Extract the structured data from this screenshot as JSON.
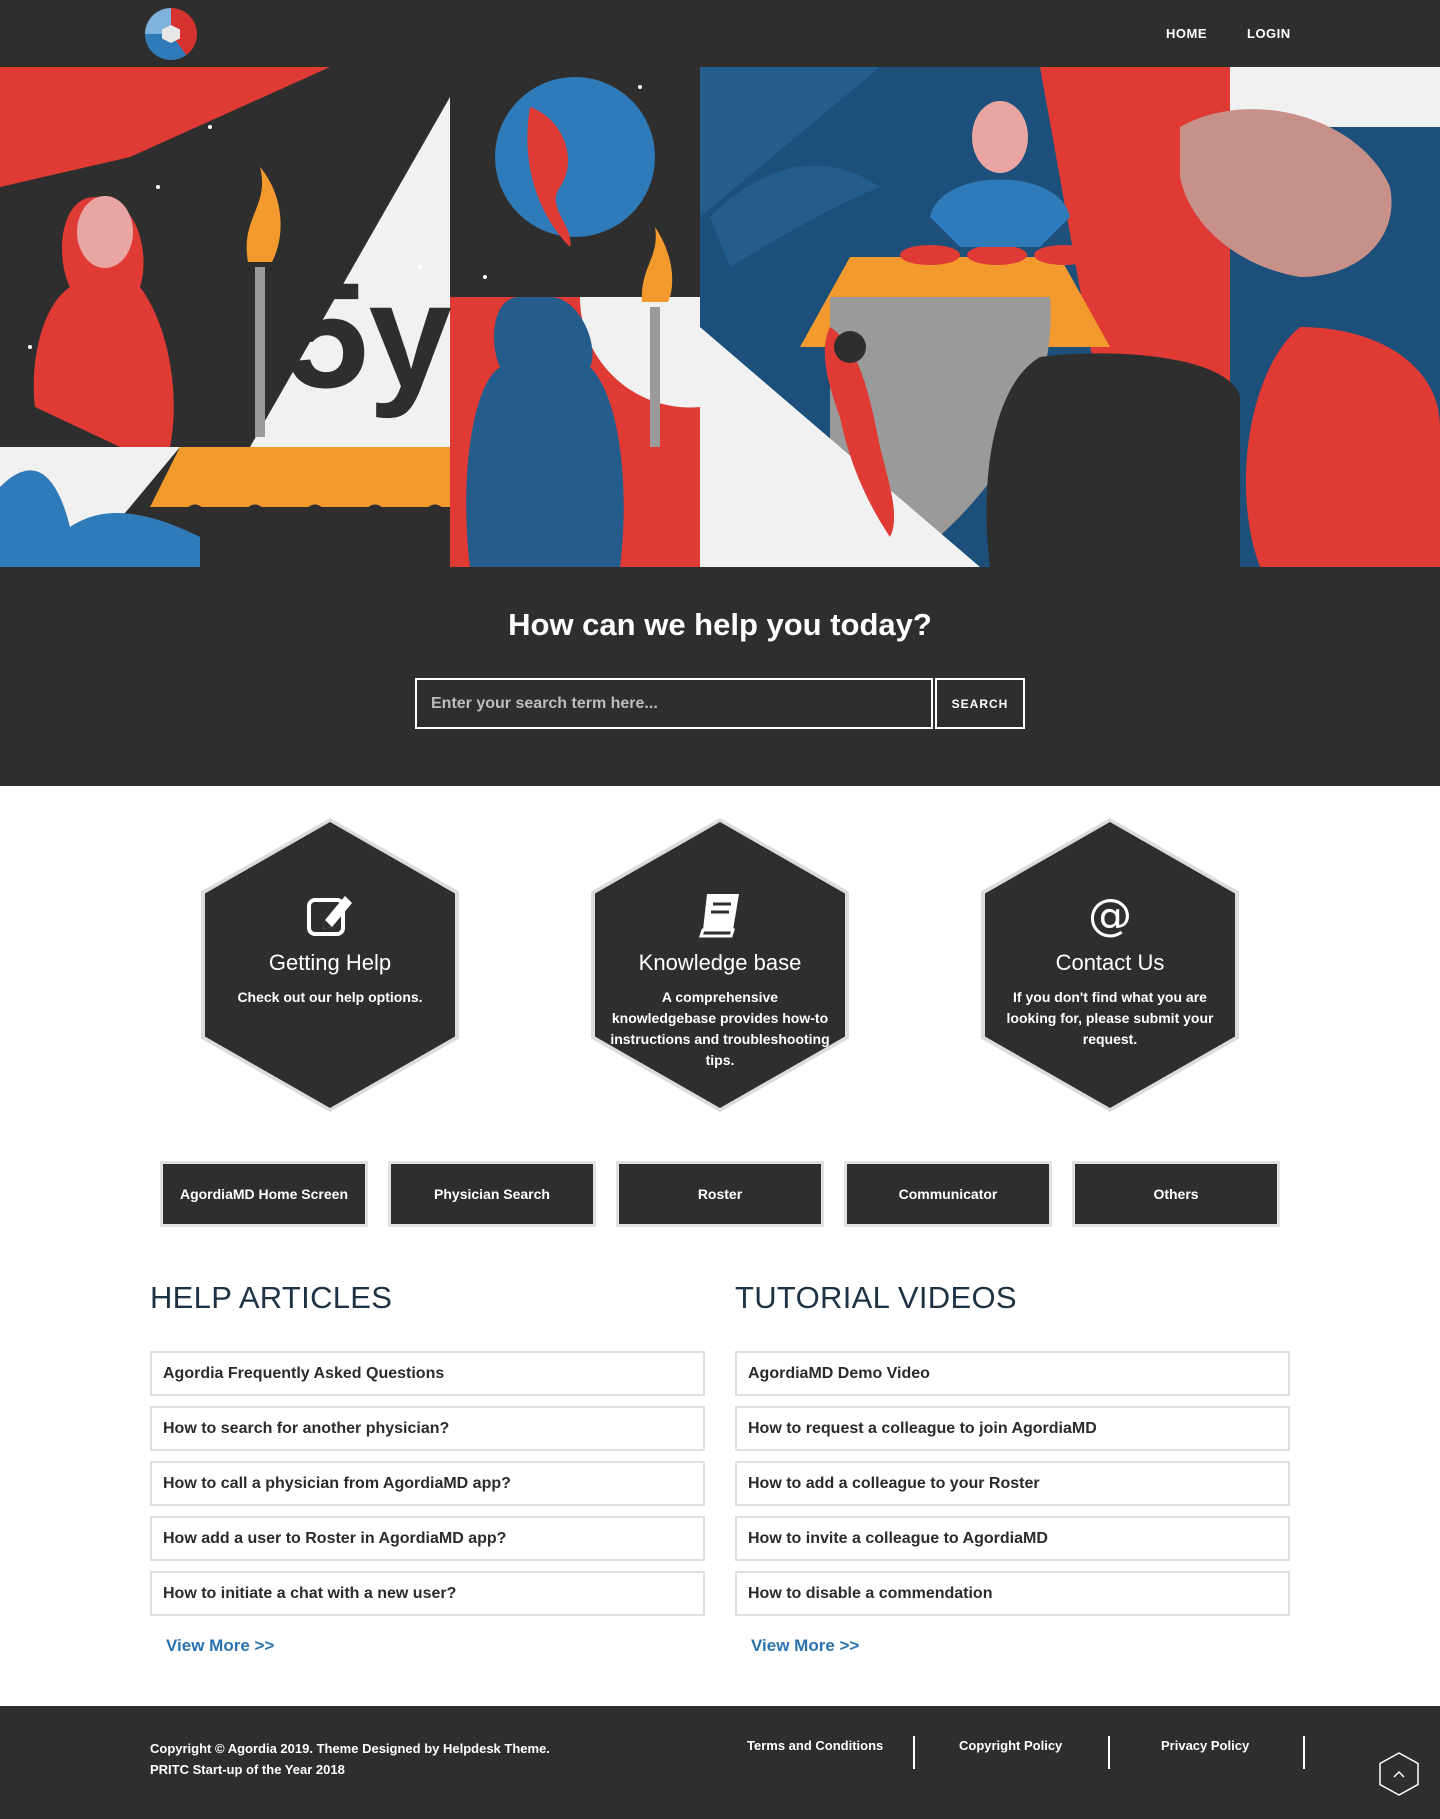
{
  "header": {
    "nav": [
      {
        "label": "HOME"
      },
      {
        "label": "LOGIN"
      }
    ]
  },
  "hero": {
    "badge_text": "5y"
  },
  "search": {
    "title": "How can we help you today?",
    "placeholder": "Enter your search term here...",
    "button_label": "SEARCH"
  },
  "features": [
    {
      "icon": "edit-icon",
      "title": "Getting Help",
      "desc": "Check out our help options."
    },
    {
      "icon": "book-icon",
      "title": "Knowledge base",
      "desc": "A comprehensive knowledgebase provides how-to instructions and troubleshooting tips."
    },
    {
      "icon": "at-icon",
      "title": "Contact Us",
      "desc": "If you don't find what you are looking for, please submit your request."
    }
  ],
  "categories": [
    "AgordiaMD Home Screen",
    "Physician Search",
    "Roster",
    "Communicator",
    "Others"
  ],
  "help_articles": {
    "title": "HELP ARTICLES",
    "items": [
      "Agordia Frequently Asked Questions",
      "How to search for another physician?",
      "How to call a physician from AgordiaMD app?",
      "How add a user to Roster in AgordiaMD app?",
      "How to initiate a chat with a new user?"
    ],
    "view_more": "View More >>"
  },
  "tutorial_videos": {
    "title": "TUTORIAL VIDEOS",
    "items": [
      "AgordiaMD Demo Video",
      "How to request a colleague to join AgordiaMD",
      "How to add a colleague to your Roster",
      "How to invite a colleague to AgordiaMD",
      "How to disable a commendation"
    ],
    "view_more": "View More >>"
  },
  "footer": {
    "copyright_line1": "Copyright © Agordia 2019. Theme Designed by Helpdesk Theme.",
    "copyright_line2": "PRITC Start-up of the Year 2018",
    "links": [
      "Terms and Conditions",
      "Copyright Policy",
      "Privacy Policy"
    ]
  },
  "colors": {
    "dark": "#2e2e2e",
    "accent_red": "#e03a35",
    "accent_blue": "#2a73b0",
    "heading_navy": "#1e3246"
  }
}
